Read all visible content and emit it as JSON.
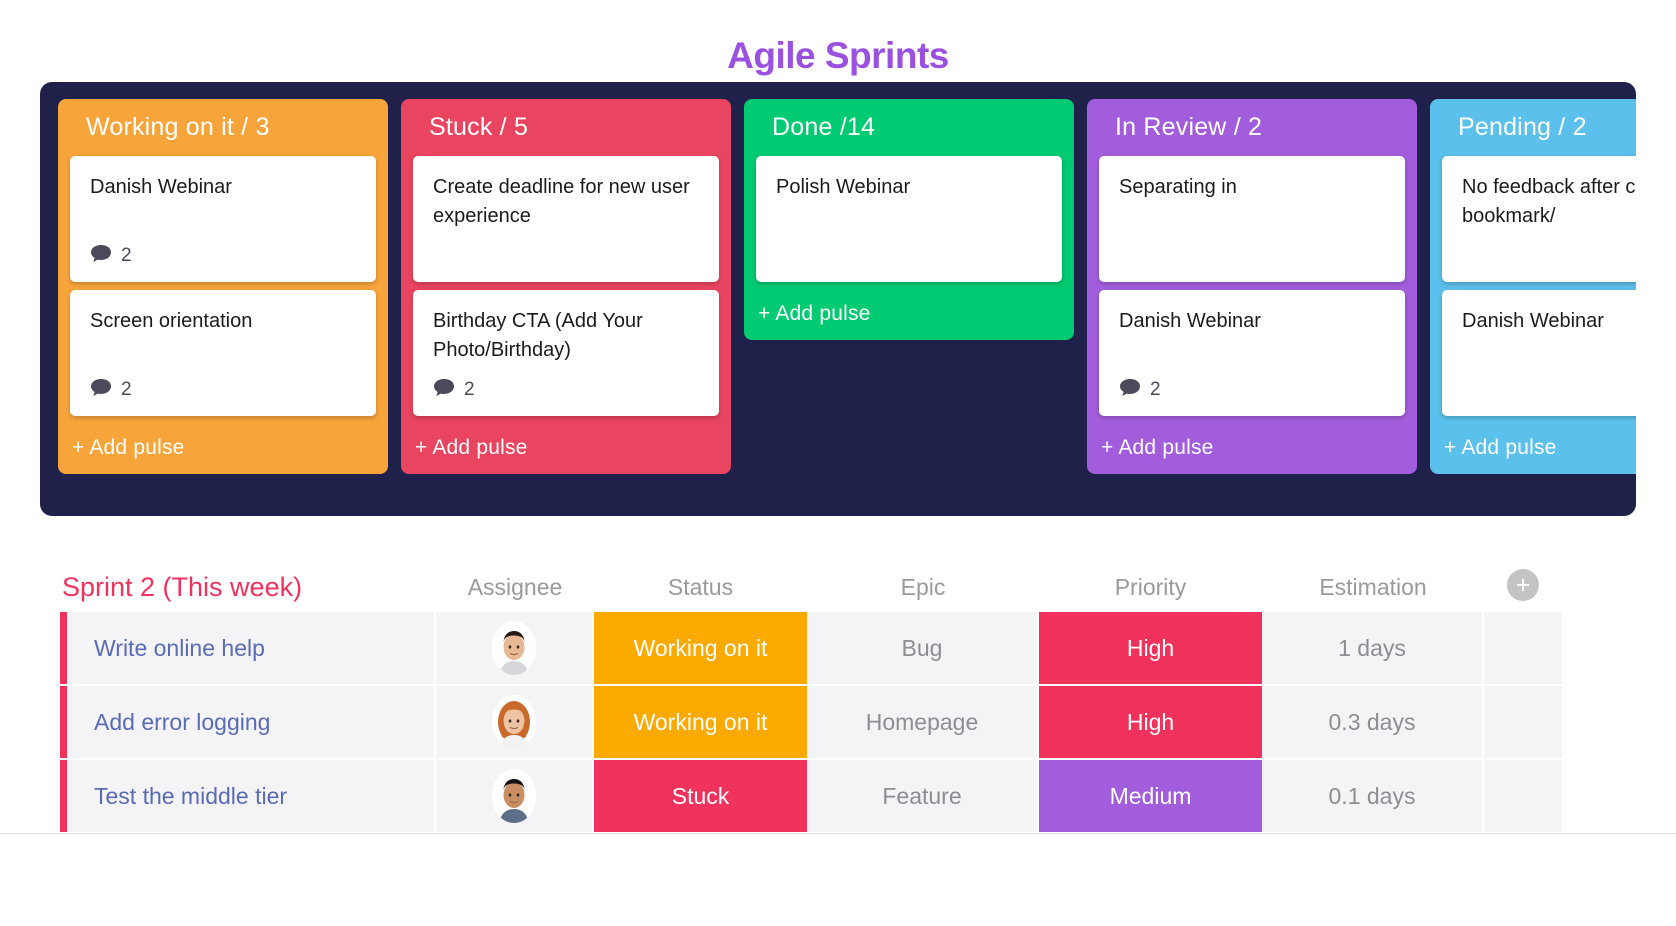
{
  "header": {
    "title": "Agile Sprints",
    "title_color": "#9b51e0"
  },
  "board": {
    "background": "#20214a",
    "columns": [
      {
        "title": "Working on it / 3",
        "color": "#f7a53b",
        "add_label": "+ Add pulse",
        "cards": [
          {
            "title": "Danish Webinar",
            "comments": "2"
          },
          {
            "title": "Screen orientation",
            "comments": "2"
          }
        ]
      },
      {
        "title": "Stuck / 5",
        "color": "#e94560",
        "add_label": "+ Add pulse",
        "cards": [
          {
            "title": "Create deadline for new user experience",
            "comments": ""
          },
          {
            "title": "Birthday CTA (Add Your Photo/Birthday)",
            "comments": "2"
          }
        ]
      },
      {
        "title": "Done /14",
        "color": "#00ca72",
        "add_label": "+ Add pulse",
        "cards": [
          {
            "title": "Polish Webinar",
            "comments": ""
          }
        ]
      },
      {
        "title": "In Review / 2",
        "color": "#a25ddc",
        "add_label": "+ Add pulse",
        "cards": [
          {
            "title": "Separating in",
            "comments": ""
          },
          {
            "title": "Danish Webinar",
            "comments": "2"
          }
        ]
      },
      {
        "title": "Pending / 2",
        "color": "#5bc0eb",
        "add_label": "+ Add pulse",
        "cards": [
          {
            "title": "No feedback after clicking bookmark/",
            "comments": ""
          },
          {
            "title": "Danish Webinar",
            "comments": ""
          }
        ]
      }
    ]
  },
  "table": {
    "sheet_name": "Sprint 2 (This week)",
    "sheet_name_color": "#f1325d",
    "add_column_label": "+",
    "headers": {
      "assignee": "Assignee",
      "status": "Status",
      "epic": "Epic",
      "priority": "Priority",
      "estimation": "Estimation"
    },
    "status_colors": {
      "Working on it": "#fcaa00",
      "Stuck": "#f1325d"
    },
    "priority_colors": {
      "High": "#f1325d",
      "Medium": "#a25ddc"
    },
    "rows": [
      {
        "name": "Write online help",
        "avatar": "avatar-male-dark-hair",
        "status": "Working on it",
        "epic": "Bug",
        "priority": "High",
        "estimation": "1 days"
      },
      {
        "name": "Add error logging",
        "avatar": "avatar-female-red-hair",
        "status": "Working on it",
        "epic": "Homepage",
        "priority": "High",
        "estimation": "0.3 days"
      },
      {
        "name": "Test the middle tier",
        "avatar": "avatar-male-short-hair",
        "status": "Stuck",
        "epic": "Feature",
        "priority": "Medium",
        "estimation": "0.1 days"
      }
    ]
  }
}
